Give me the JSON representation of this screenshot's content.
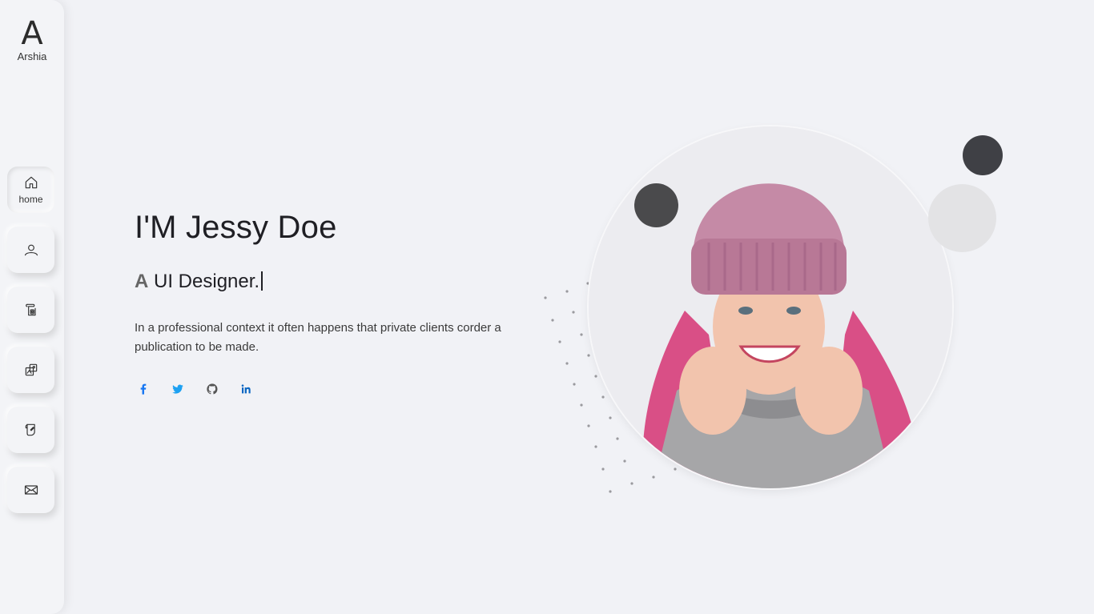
{
  "brand": {
    "mark": "A",
    "name": "Arshia"
  },
  "nav": [
    {
      "id": "home",
      "label": "home",
      "icon": "home-icon",
      "active": true
    },
    {
      "id": "about",
      "label": "",
      "icon": "user-icon",
      "active": false
    },
    {
      "id": "resume",
      "label": "",
      "icon": "resume-icon",
      "active": false
    },
    {
      "id": "portfolio",
      "label": "",
      "icon": "portfolio-icon",
      "active": false
    },
    {
      "id": "blog",
      "label": "",
      "icon": "blog-icon",
      "active": false
    },
    {
      "id": "contact",
      "label": "",
      "icon": "envelope-icon",
      "active": false
    }
  ],
  "hero": {
    "title": "I'M Jessy Doe",
    "subtitle_prefix": "A",
    "subtitle": "UI Designer.",
    "description": "In a professional context it often happens that private clients corder a publication to be made."
  },
  "socials": [
    {
      "name": "facebook",
      "icon": "facebook-icon",
      "color": "#1877f2"
    },
    {
      "name": "twitter",
      "icon": "twitter-icon",
      "color": "#1da1f2"
    },
    {
      "name": "github",
      "icon": "github-icon",
      "color": "#555555"
    },
    {
      "name": "linkedin",
      "icon": "linkedin-icon",
      "color": "#0a66c2"
    }
  ],
  "colors": {
    "background": "#f1f2f6",
    "text": "#1f1f24",
    "accent_dark": "#4a4a4c",
    "accent_light": "#e3e3e5"
  }
}
